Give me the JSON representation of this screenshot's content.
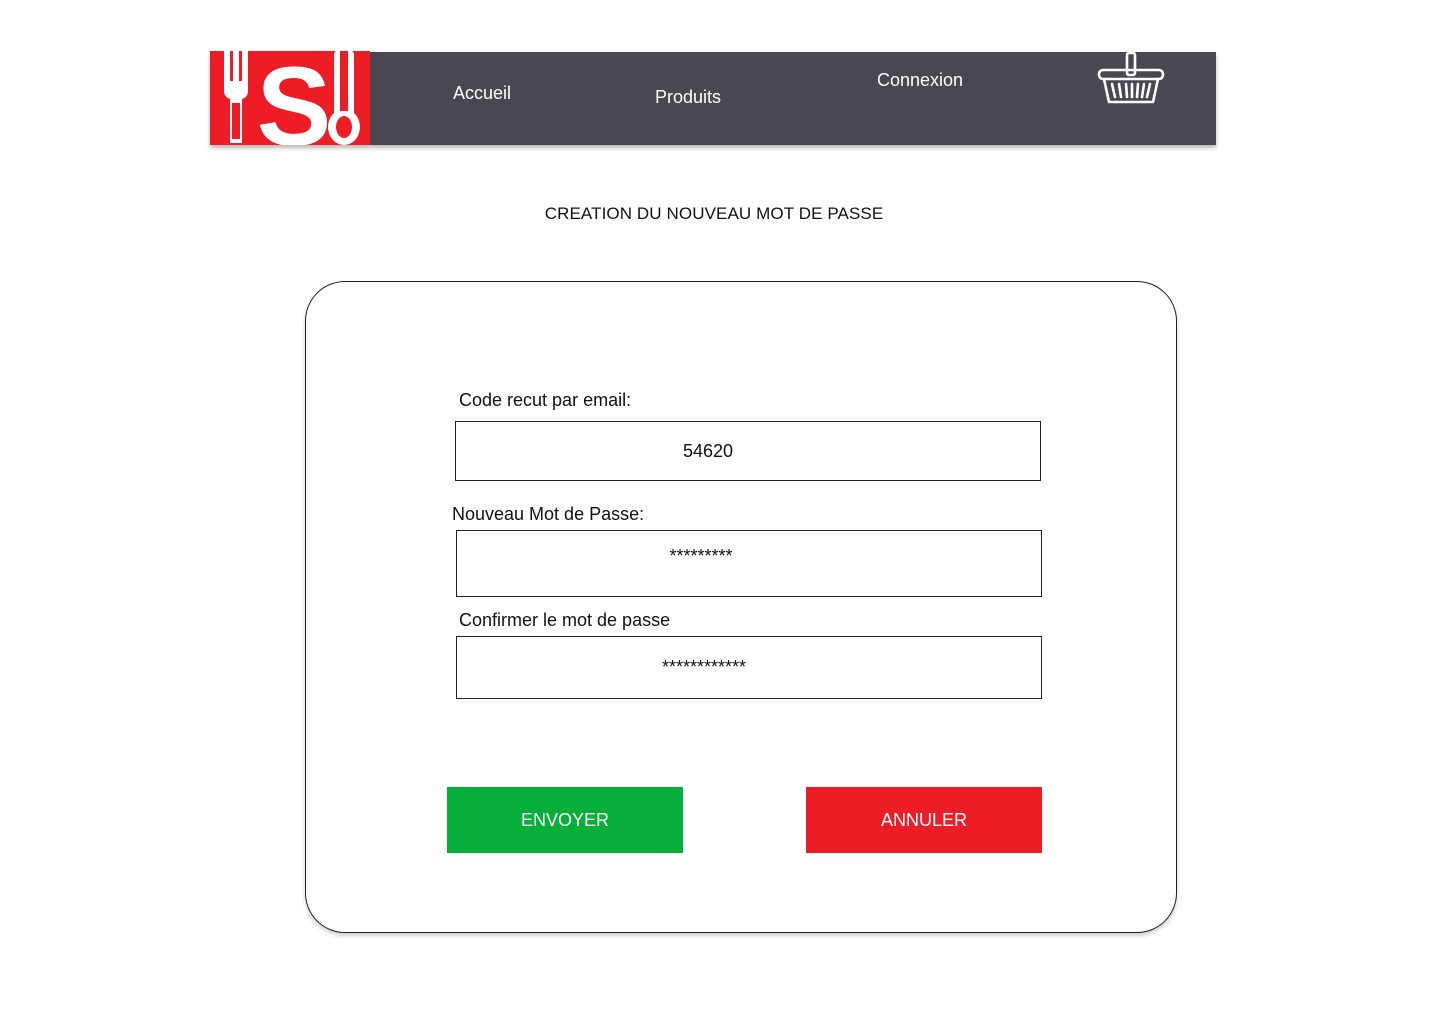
{
  "colors": {
    "header_bg": "#4a4751",
    "logo_bg": "#ee1c24",
    "send_button": "#06ae3a",
    "cancel_button": "#ee1c24"
  },
  "header": {
    "logo_icon": "restaurant-s-fork-spoon-logo",
    "nav": {
      "home": "Accueil",
      "products": "Produits",
      "login": "Connexion"
    },
    "cart_icon": "shopping-basket-icon"
  },
  "title": "CREATION DU NOUVEAU MOT DE PASSE",
  "form": {
    "code": {
      "label": "Code recut par email:",
      "value": "54620"
    },
    "new_password": {
      "label": "Nouveau Mot de Passe:",
      "value": "*********"
    },
    "confirm_password": {
      "label": "Confirmer le mot de passe",
      "value": "************"
    },
    "send_label": "ENVOYER",
    "cancel_label": "ANNULER"
  }
}
